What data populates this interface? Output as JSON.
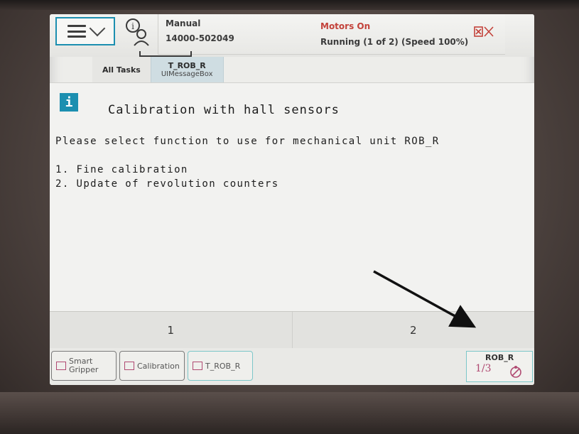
{
  "header": {
    "mode": "Manual",
    "controller": "14000-502049",
    "motors_state": "Motors On",
    "run_state": "Running (1 of 2) (Speed 100%)"
  },
  "tabs": [
    {
      "label": "All Tasks",
      "sublabel": ""
    },
    {
      "label": "T_ROB_R",
      "sublabel": "UIMessageBox"
    }
  ],
  "message": {
    "title": "Calibration with hall sensors",
    "body": "Please select function to use for mechanical unit ROB_R",
    "options": [
      "1. Fine calibration",
      "2. Update of revolution counters"
    ]
  },
  "choices": [
    "1",
    "2"
  ],
  "taskbar": {
    "items": [
      {
        "label": "Smart\nGripper"
      },
      {
        "label": "Calibration"
      },
      {
        "label": "T_ROB_R"
      }
    ],
    "quickset": {
      "unit": "ROB_R",
      "fraction_num": "1",
      "fraction_den": "3"
    }
  },
  "colors": {
    "accent": "#1c8fb0",
    "motors_on": "#c3423a",
    "task_icon": "#b04a72"
  }
}
